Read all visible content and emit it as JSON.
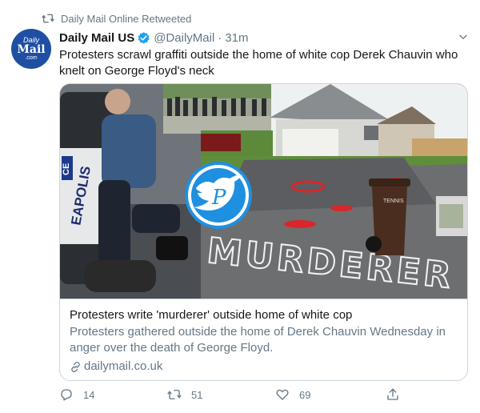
{
  "retweet": {
    "text": "Daily Mail Online Retweeted"
  },
  "account": {
    "avatar_line1": "Daily",
    "avatar_line2": "Mail",
    "avatar_line3": ".com",
    "name": "Daily Mail US",
    "handle": "@DailyMail",
    "separator": "·",
    "time": "31m"
  },
  "tweet": {
    "text": "Protesters scrawl graffiti outside the home of white cop Derek Chauvin who knelt on George Floyd's neck"
  },
  "card": {
    "image_text_police_car": "EAPOLIS",
    "image_text_ce": "CE",
    "image_text_graffiti": "MURDERER",
    "image_text_bin": "TENNIS",
    "title": "Protesters write 'murderer' outside home of white cop",
    "description": "Protesters gathered outside the home of Derek Chauvin Wednesday in anger over the death of George Floyd.",
    "domain": "dailymail.co.uk"
  },
  "actions": {
    "replies": "14",
    "retweets": "51",
    "likes": "69"
  },
  "colors": {
    "accent": "#1da1f2",
    "text_primary": "#14171a",
    "text_secondary": "#657786",
    "border": "#ccd6dd",
    "avatar_bg": "#1e4fa3",
    "graffiti_red": "#d8262a"
  },
  "icons": {
    "retweet_header": "retweet-icon",
    "verified": "verified-badge-icon",
    "more": "chevron-down-icon",
    "link": "link-icon",
    "reply": "reply-icon",
    "retweet": "retweet-icon",
    "like": "heart-icon",
    "share": "share-icon",
    "watermark": "twitter-bird-watermark-icon"
  }
}
